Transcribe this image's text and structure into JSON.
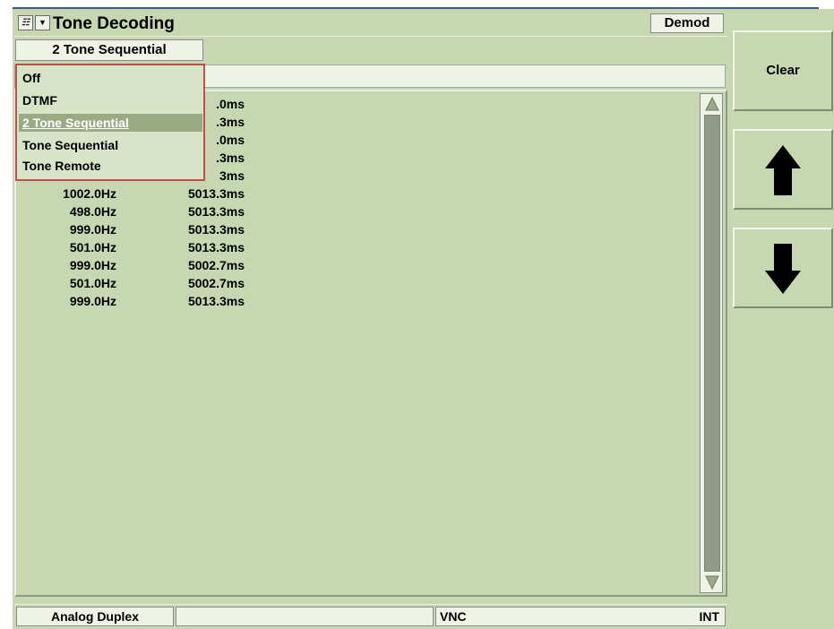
{
  "window": {
    "title": "Tone Decoding",
    "demod_label": "Demod",
    "mode_button_label": "2 Tone Sequential"
  },
  "dropdown": {
    "items": [
      {
        "label": "Off"
      },
      {
        "label": "DTMF"
      },
      {
        "label": "2 Tone Sequential",
        "selected": true
      },
      {
        "label": "Tone Sequential"
      },
      {
        "label": "Tone Remote"
      }
    ]
  },
  "tone_list": {
    "partial_durations": [
      ".0ms",
      ".3ms",
      ".0ms",
      ".3ms",
      "3ms"
    ],
    "rows": [
      {
        "freq": "1002.0Hz",
        "duration": "5013.3ms"
      },
      {
        "freq": "498.0Hz",
        "duration": "5013.3ms"
      },
      {
        "freq": "999.0Hz",
        "duration": "5013.3ms"
      },
      {
        "freq": "501.0Hz",
        "duration": "5013.3ms"
      },
      {
        "freq": "999.0Hz",
        "duration": "5002.7ms"
      },
      {
        "freq": "501.0Hz",
        "duration": "5002.7ms"
      },
      {
        "freq": "999.0Hz",
        "duration": "5013.3ms"
      }
    ]
  },
  "status_bar": {
    "mode": "Analog Duplex",
    "middle": "",
    "connection": "VNC",
    "ref": "INT"
  },
  "side_buttons": {
    "clear_label": "Clear",
    "up_icon": "arrow-up-icon",
    "down_icon": "arrow-down-icon"
  },
  "colors": {
    "background": "#c6d7b1",
    "dropdown_border": "#c54c4c",
    "selection": "#9aab84"
  }
}
